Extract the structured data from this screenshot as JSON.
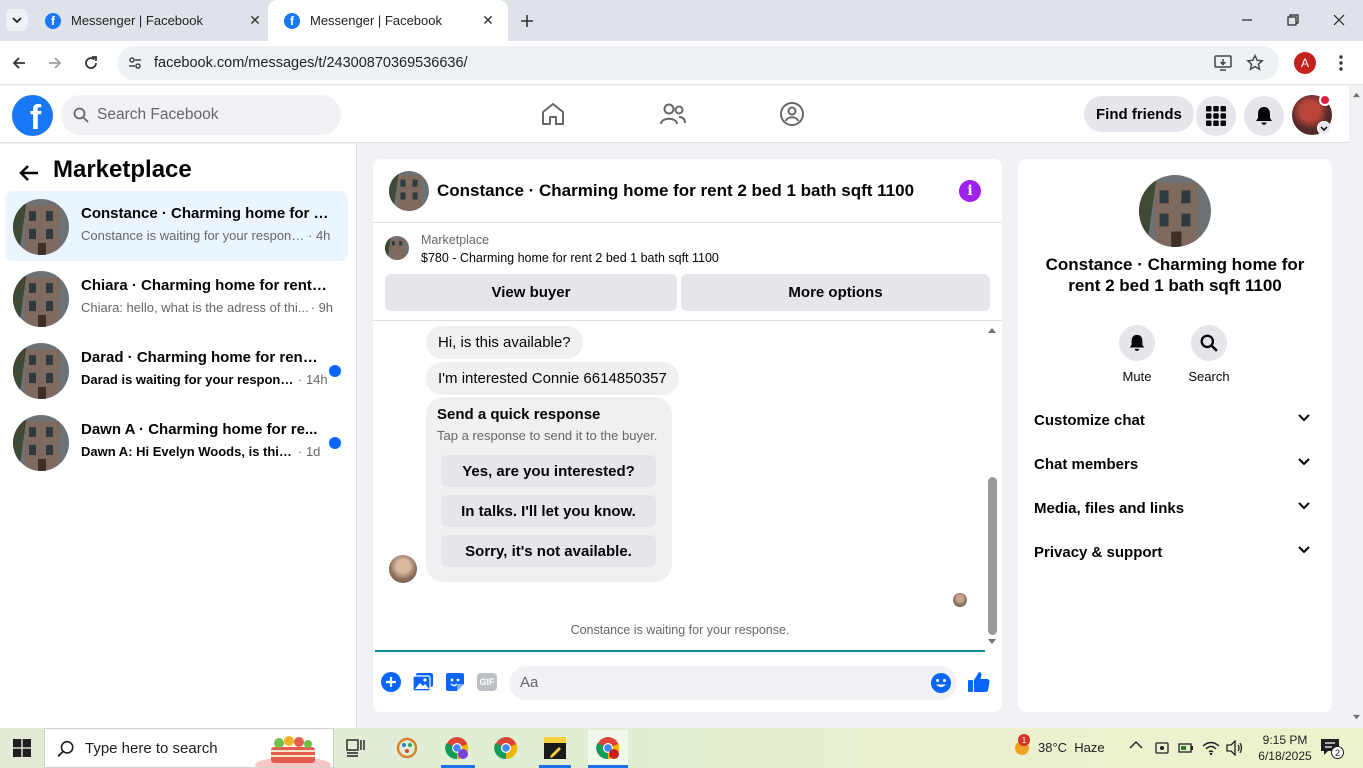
{
  "browser": {
    "tabs": [
      {
        "title": "Messenger | Facebook",
        "active": false
      },
      {
        "title": "Messenger | Facebook",
        "active": true
      }
    ],
    "url": "facebook.com/messages/t/24300870369536636/",
    "profile_initial": "A"
  },
  "fb_header": {
    "logo_letter": "f",
    "search_placeholder": "Search Facebook",
    "find_friends_label": "Find friends"
  },
  "sidebar": {
    "title": "Marketplace",
    "conversations": [
      {
        "name": "Constance · Charming home for re...",
        "preview": "Constance is waiting for your response.",
        "time": "· 4h",
        "unread": false,
        "bold": false,
        "active": true
      },
      {
        "name": "Chiara · Charming home for rent 2...",
        "preview": "Chiara: hello, what is the adress of thi...",
        "time": "· 9h",
        "unread": false,
        "bold": false,
        "active": false
      },
      {
        "name": "Darad · Charming home for rent ...",
        "preview": "Darad is waiting for your response.",
        "time": "· 14h",
        "unread": true,
        "bold": true,
        "active": false
      },
      {
        "name": "Dawn A · Charming home for re...",
        "preview": "Dawn A: Hi Evelyn Woods, is this s...",
        "time": "· 1d",
        "unread": true,
        "bold": true,
        "active": false
      }
    ]
  },
  "chat": {
    "title": "Constance · Charming home for rent 2 bed 1 bath sqft 1100",
    "marketplace_label": "Marketplace",
    "listing": "$780 - Charming home for rent 2 bed 1 bath sqft 1100",
    "view_buyer_label": "View buyer",
    "more_options_label": "More options",
    "messages": [
      "Hi, is this available?",
      "I'm interested Connie 6614850357"
    ],
    "quick_response": {
      "title": "Send a quick response",
      "subtitle": "Tap a response to send it to the buyer.",
      "options": [
        "Yes, are you interested?",
        "In talks. I'll let you know.",
        "Sorry, it's not available."
      ]
    },
    "waiting_notice": "Constance is waiting for your response.",
    "composer_placeholder": "Aa",
    "gif_label": "GIF"
  },
  "details": {
    "name": "Constance · Charming home for rent 2 bed 1 bath sqft 1100",
    "actions": [
      {
        "label": "Mute",
        "icon": "bell-icon"
      },
      {
        "label": "Search",
        "icon": "search-icon"
      }
    ],
    "sections": [
      "Customize chat",
      "Chat members",
      "Media, files and links",
      "Privacy & support"
    ]
  },
  "taskbar": {
    "search_placeholder": "Type here to search",
    "weather": "38°C  Haze",
    "time": "9:15 PM",
    "date": "6/18/2025",
    "weather_badge": "1",
    "notification_count": "2"
  },
  "colors": {
    "fb_blue": "#1877f2",
    "messenger_blue": "#0866ff",
    "info_purple": "#a020f0",
    "active_row": "#ebf5ff"
  }
}
